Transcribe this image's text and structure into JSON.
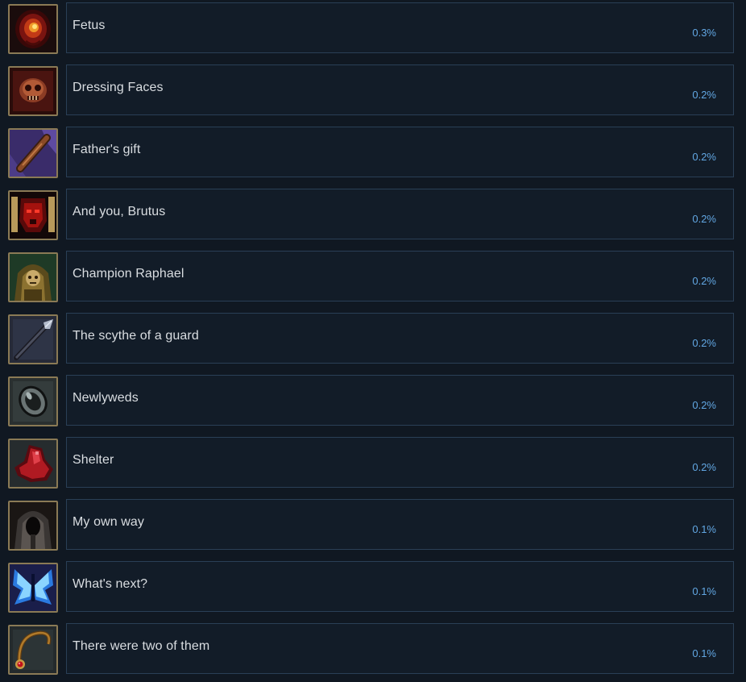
{
  "achievements": [
    {
      "name": "Fetus",
      "percent": "0.3%",
      "icon": "fetus-icon"
    },
    {
      "name": "Dressing Faces",
      "percent": "0.2%",
      "icon": "skull-face-icon"
    },
    {
      "name": "Father's gift",
      "percent": "0.2%",
      "icon": "wooden-club-icon"
    },
    {
      "name": "And you, Brutus",
      "percent": "0.2%",
      "icon": "red-mask-icon"
    },
    {
      "name": "Champion Raphael",
      "percent": "0.2%",
      "icon": "hooded-champion-icon"
    },
    {
      "name": "The scythe of a guard",
      "percent": "0.2%",
      "icon": "spear-icon"
    },
    {
      "name": "Newlyweds",
      "percent": "0.2%",
      "icon": "ring-icon"
    },
    {
      "name": "Shelter",
      "percent": "0.2%",
      "icon": "red-cloak-icon"
    },
    {
      "name": "My own way",
      "percent": "0.1%",
      "icon": "hooded-figure-icon"
    },
    {
      "name": "What's next?",
      "percent": "0.1%",
      "icon": "butterfly-icon"
    },
    {
      "name": "There were two of them",
      "percent": "0.1%",
      "icon": "amulet-icon"
    }
  ]
}
